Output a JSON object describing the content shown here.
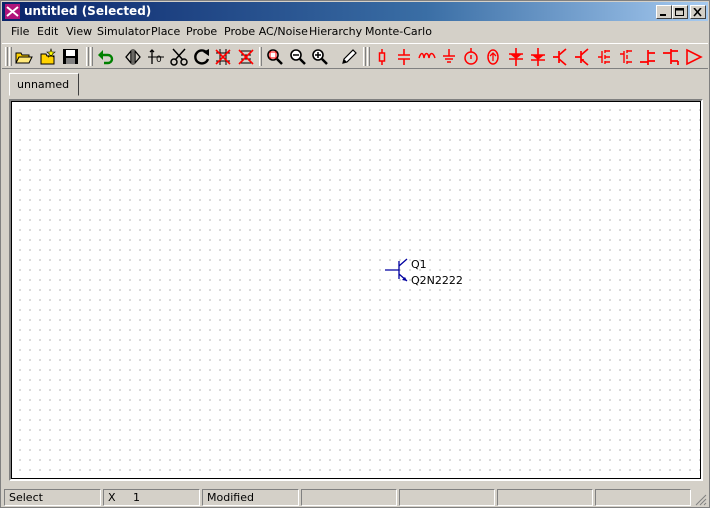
{
  "window": {
    "title": "untitled (Selected)"
  },
  "menubar": {
    "items": [
      {
        "label": "File"
      },
      {
        "label": "Edit"
      },
      {
        "label": "View"
      },
      {
        "label": "Simulator"
      },
      {
        "label": "Place"
      },
      {
        "label": "Probe"
      },
      {
        "label": "Probe AC/Noise"
      },
      {
        "label": "Hierarchy"
      },
      {
        "label": "Monte-Carlo"
      }
    ]
  },
  "toolbar": {
    "icons": [
      "open-folder-icon",
      "new-folder-icon",
      "save-icon",
      "undo-icon",
      "mirror-horizontal-icon",
      "mirror-vertical-icon",
      "cut-icon",
      "rotate-icon",
      "delete-icon",
      "delete-all-icon",
      "zoom-area-icon",
      "zoom-out-icon",
      "zoom-in-icon",
      "pencil-icon",
      "resistor-icon",
      "capacitor-icon",
      "inductor-icon",
      "ground-icon",
      "voltage-source-icon",
      "current-source-icon",
      "diode-icon",
      "zener-diode-icon",
      "npn-transistor-icon",
      "pnp-transistor-icon",
      "nmos-icon",
      "pmos-icon",
      "njfet-icon",
      "pjfet-icon",
      "opamp-icon"
    ],
    "accent": "#ff0000"
  },
  "tabs": [
    {
      "label": "unnamed"
    }
  ],
  "schematic": {
    "component": {
      "ref": "Q1",
      "model": "Q2N2222"
    },
    "wire_color": "#0000a0"
  },
  "statusbar": {
    "mode": "Select",
    "coord": "X     1",
    "state": "Modified"
  }
}
